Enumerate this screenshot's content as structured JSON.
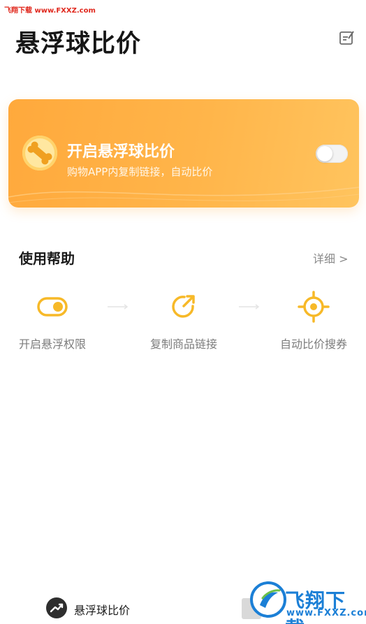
{
  "watermark": {
    "top_text": "飞翔下载 www.FXXZ.com",
    "badge_text": "飞翔下载",
    "badge_url": "www.FXXZ.com"
  },
  "header": {
    "title": "悬浮球比价",
    "edit_icon": "edit-note-icon"
  },
  "banner": {
    "title": "开启悬浮球比价",
    "subtitle": "购物APP内复制链接，自动比价",
    "toggle_on": false,
    "gradient_start": "#ffa93c",
    "gradient_end": "#ffc45e"
  },
  "help": {
    "title": "使用帮助",
    "more_label": "详细 >",
    "steps": [
      {
        "label": "开启悬浮权限",
        "icon": "toggle-icon"
      },
      {
        "label": "复制商品链接",
        "icon": "share-arrow-icon"
      },
      {
        "label": "自动比价搜券",
        "icon": "target-icon"
      }
    ],
    "accent_color": "#f7b928"
  },
  "tabbar": {
    "label": "悬浮球比价",
    "icon": "trend-logo-icon"
  }
}
